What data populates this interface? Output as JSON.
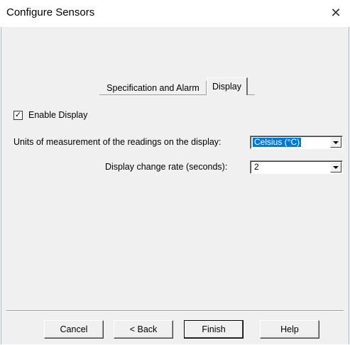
{
  "window": {
    "title": "Configure Sensors",
    "close_glyph": "✕"
  },
  "tabs": [
    {
      "label": "Specification and Alarm",
      "active": false
    },
    {
      "label": "Display",
      "active": true
    }
  ],
  "display_tab": {
    "enable_display": {
      "label": "Enable Display",
      "checked": true,
      "check_glyph": "✓"
    },
    "units": {
      "label": "Units of measurement of the readings on the display:",
      "value": "Celsius (°C)"
    },
    "change_rate": {
      "label": "Display change rate (seconds):",
      "value": "2"
    }
  },
  "buttons": {
    "cancel": "Cancel",
    "back": "< Back",
    "finish": "Finish",
    "help": "Help"
  },
  "colors": {
    "selection": "#0078d7",
    "face": "#f0f0f0"
  }
}
